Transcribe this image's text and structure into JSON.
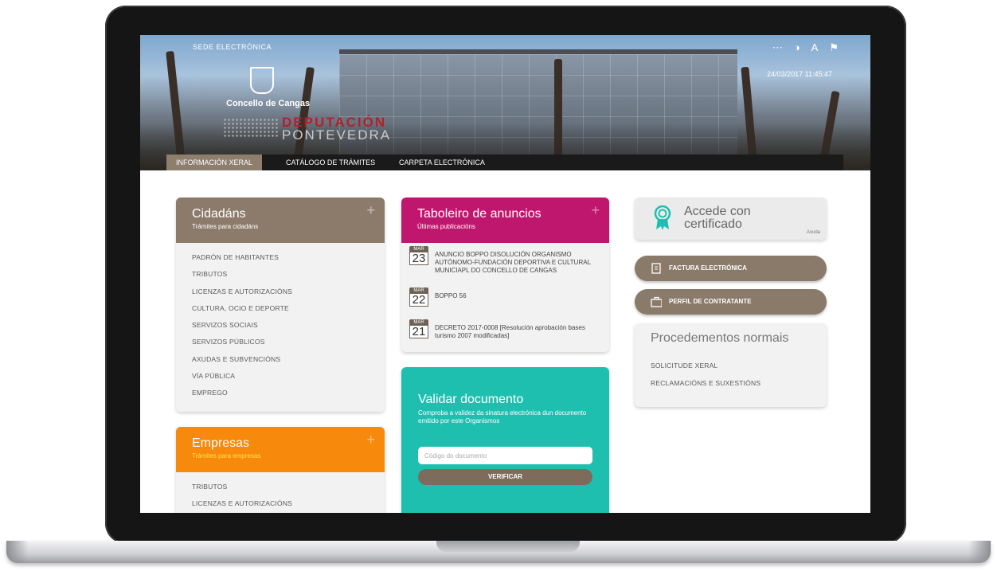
{
  "header": {
    "sede_label": "SEDE ELECTRÓNICA",
    "concello_name": "Concello de Cangas",
    "deputacion_line1": "DEPUTACIÓN",
    "deputacion_line2": "PONTEVEDRA",
    "datetime": "24/03/2017 11:45:47",
    "tools": [
      "sitemap-icon",
      "contrast-icon",
      "font-size-icon",
      "flag-icon"
    ]
  },
  "nav": {
    "items": [
      "INFORMACIÓN XERAL",
      "CATÁLOGO DE TRÁMITES",
      "CARPETA ELECTRÓNICA"
    ]
  },
  "cidadans": {
    "title": "Cidadáns",
    "subtitle": "Trámites para cidadáns",
    "color": "#8c7b6b",
    "items": [
      "PADRÓN DE HABITANTES",
      "TRIBUTOS",
      "LICENZAS E AUTORIZACIÓNS",
      "CULTURA, OCIO E DEPORTE",
      "SERVIZOS SOCIAIS",
      "SERVIZOS PÚBLICOS",
      "AXUDAS E SUBVENCIÓNS",
      "VÍA PÚBLICA",
      "EMPREGO"
    ]
  },
  "empresas": {
    "title": "Empresas",
    "subtitle": "Trámites para empresas",
    "color": "#f7890c",
    "items": [
      "TRIBUTOS",
      "LICENZAS E AUTORIZACIÓNS"
    ]
  },
  "taboleiro": {
    "title": "Taboleiro de anuncios",
    "subtitle": "Últimas publicacións",
    "color": "#c0176e",
    "announcements": [
      {
        "month": "MAR",
        "day": "23",
        "text": "ANUNCIO BOPPO DISOLUCIÓN ORGANISMO AUTÓNOMO-FUNDACIÓN DEPORTIVA E CULTURAL MUNICIAPL DO CONCELLO DE CANGAS"
      },
      {
        "month": "MAR",
        "day": "22",
        "text": "BOPPO 56"
      },
      {
        "month": "MAR",
        "day": "21",
        "text": "DECRETO 2017-0008 [Resolución aprobación bases turismo 2007 modificadas]"
      }
    ]
  },
  "validar": {
    "title": "Validar documento",
    "subtitle": "Comproba a validez da sinatura electrónica dun documento emitido por este Organismos",
    "placeholder": "Código do documento",
    "button": "VERIFICAR",
    "color": "#1fbfb0"
  },
  "certificado": {
    "title": "Accede con certificado",
    "help": "Axuda"
  },
  "factura": {
    "label": "FACTURA ELECTRÓNICA"
  },
  "perfil": {
    "label": "PERFIL DE CONTRATANTE"
  },
  "procedementos": {
    "title": "Procedementos normais",
    "items": [
      "SOLICITUDE XERAL",
      "RECLAMACIÓNS E SUXESTIÓNS"
    ]
  }
}
